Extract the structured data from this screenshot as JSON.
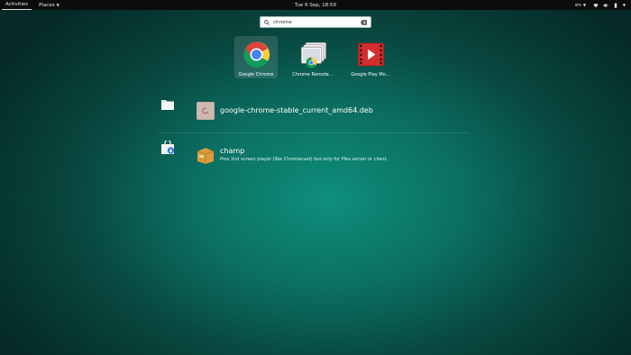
{
  "topbar": {
    "activities": "Activities",
    "places": "Places",
    "clock": "Tue  6 Sep, 18:59",
    "keyboard": "en"
  },
  "search": {
    "query": "chrome",
    "icon": "search-icon"
  },
  "apps": [
    {
      "label": "Google Chrome",
      "icon": "google-chrome-icon",
      "selected": true
    },
    {
      "label": "Chrome Remote…",
      "icon": "chrome-remote-desktop-icon",
      "selected": false
    },
    {
      "label": "Google Play Mo…",
      "icon": "google-play-movies-icon",
      "selected": false
    }
  ],
  "results": [
    {
      "provider_icon": "files-icon",
      "icon": "deb-package-icon",
      "title": "google-chrome-stable_current_amd64.deb",
      "description": ""
    },
    {
      "provider_icon": "software-center-icon",
      "icon": "package-box-icon",
      "title": "champ",
      "description": "Plex 2nd screen player (like Chromecast) but only for Plex server or client."
    }
  ]
}
